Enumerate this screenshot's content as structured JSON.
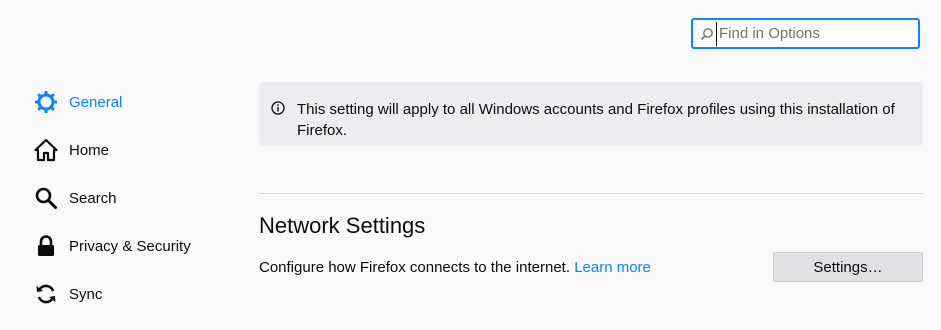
{
  "search": {
    "placeholder": "Find in Options",
    "value": ""
  },
  "sidebar": {
    "items": [
      {
        "label": "General",
        "icon": "gear-icon",
        "selected": true
      },
      {
        "label": "Home",
        "icon": "home-icon",
        "selected": false
      },
      {
        "label": "Search",
        "icon": "search-icon",
        "selected": false
      },
      {
        "label": "Privacy & Security",
        "icon": "lock-icon",
        "selected": false
      },
      {
        "label": "Sync",
        "icon": "sync-icon",
        "selected": false
      }
    ]
  },
  "notice": {
    "icon": "info-icon",
    "text": "This setting will apply to all Windows accounts and Firefox profiles using this installation of Firefox."
  },
  "network": {
    "title": "Network Settings",
    "description": "Configure how Firefox connects to the internet.",
    "learn_more": "Learn more",
    "button_label": "Settings…"
  },
  "colors": {
    "accent": "#0a84ff",
    "background": "#f9f9fa",
    "notice_bg": "#ededf0"
  }
}
